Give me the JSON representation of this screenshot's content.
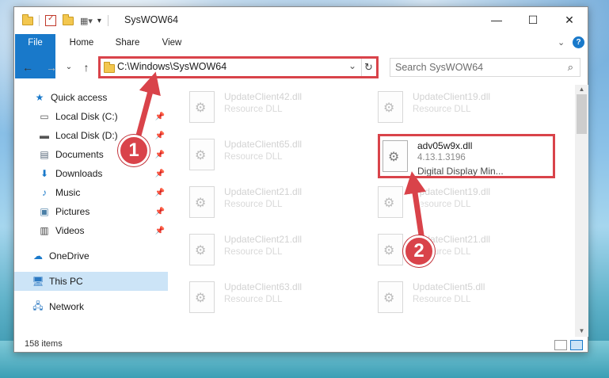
{
  "window": {
    "title": "SysWOW64",
    "controls": {
      "minimize": "—",
      "maximize": "☐",
      "close": "✕"
    }
  },
  "ribbon": {
    "tabs": [
      "File",
      "Home",
      "Share",
      "View"
    ],
    "help": "?"
  },
  "address": {
    "path": "C:\\Windows\\SysWOW64",
    "dropdown": "⌄",
    "refresh": "↻"
  },
  "search": {
    "placeholder": "Search SysWOW64",
    "icon": "search-icon"
  },
  "nav": {
    "back": "←",
    "forward": "→",
    "recent": "⌄",
    "up": "↑",
    "items": [
      {
        "label": "Quick access",
        "icon": "star-icon",
        "pinned": false
      },
      {
        "label": "Local Disk (C:)",
        "icon": "drive-icon",
        "pinned": true
      },
      {
        "label": "Local Disk (D:)",
        "icon": "drive-icon",
        "pinned": true
      },
      {
        "label": "Documents",
        "icon": "documents-icon",
        "pinned": true
      },
      {
        "label": "Downloads",
        "icon": "download-icon",
        "pinned": true
      },
      {
        "label": "Music",
        "icon": "music-icon",
        "pinned": true
      },
      {
        "label": "Pictures",
        "icon": "pictures-icon",
        "pinned": true
      },
      {
        "label": "Videos",
        "icon": "videos-icon",
        "pinned": true
      },
      {
        "label": "OneDrive",
        "icon": "cloud-icon",
        "pinned": false
      },
      {
        "label": "This PC",
        "icon": "computer-icon",
        "pinned": false,
        "selected": true
      },
      {
        "label": "Network",
        "icon": "network-icon",
        "pinned": false
      }
    ]
  },
  "files": {
    "left": [
      {
        "name": "UpdateClient42.dll",
        "type": "Resource DLL"
      },
      {
        "name": "UpdateClient65.dll",
        "type": "Resource DLL"
      },
      {
        "name": "UpdateClient21.dll",
        "type": "Resource DLL"
      },
      {
        "name": "UpdateClient21.dll",
        "type": "Resource DLL"
      },
      {
        "name": "UpdateClient63.dll",
        "type": "Resource DLL"
      }
    ],
    "right": [
      {
        "name": "UpdateClient19.dll",
        "type": "Resource DLL"
      },
      {
        "name": "adv05w9x.dll",
        "version": "4.13.1.3196",
        "description": "Digital Display Min...",
        "active": true
      },
      {
        "name": "UpdateClient19.dll",
        "type": "Resource DLL"
      },
      {
        "name": "UpdateClient21.dll",
        "type": "Resource DLL"
      },
      {
        "name": "UpdateClient5.dll",
        "type": "Resource DLL"
      }
    ]
  },
  "status": {
    "item_count": "158 items"
  },
  "annotations": {
    "step1": "1",
    "step2": "2",
    "color": "#d9434a"
  }
}
